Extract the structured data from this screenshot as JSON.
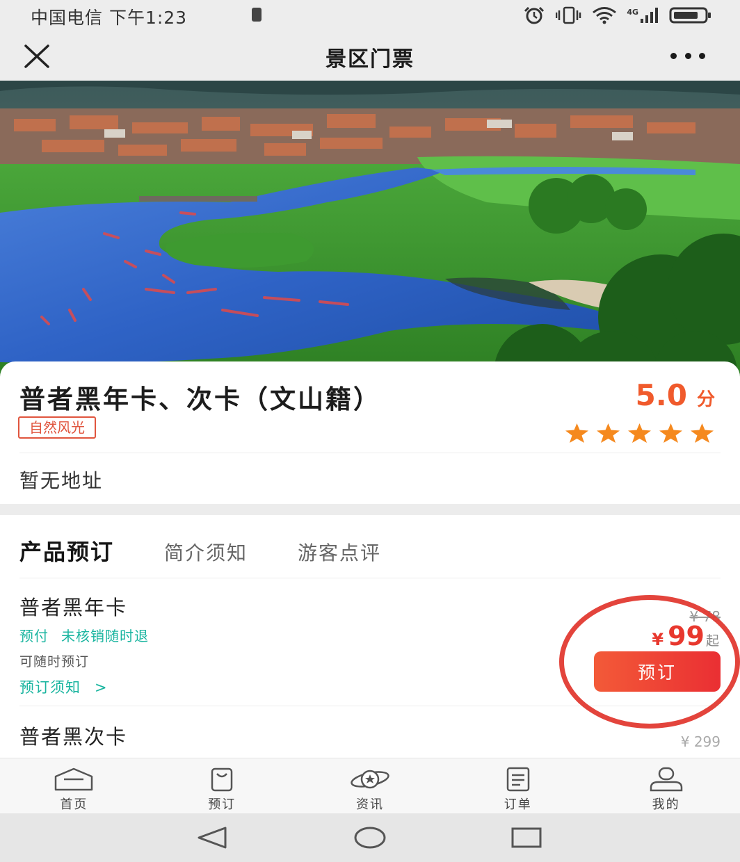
{
  "status_bar": {
    "carrier_time": "中国电信 下午1:23",
    "network_type": "4G"
  },
  "nav": {
    "title": "景区门票"
  },
  "spot": {
    "title": "普者黑年卡、次卡（文山籍）",
    "tag": "自然风光",
    "score": "5.0",
    "score_unit": "分",
    "rating_stars": 5,
    "address": "暂无地址"
  },
  "tabs": [
    "产品预订",
    "简介须知",
    "游客点评"
  ],
  "tickets": [
    {
      "name": "普者黑年卡",
      "policy": [
        "预付",
        "未核销随时退"
      ],
      "availability": "可随时预订",
      "notice": "预订须知",
      "notice_chevron": ">",
      "original_price": "¥ 78",
      "currency": "¥",
      "price": "99",
      "price_suffix": "起",
      "book_label": "预订"
    },
    {
      "name": "普者黑次卡",
      "original_price": "¥ 299"
    }
  ],
  "tabbar": [
    {
      "label": "首页",
      "icon": "home-icon"
    },
    {
      "label": "预订",
      "icon": "shopping-bag-icon"
    },
    {
      "label": "资讯",
      "icon": "planet-icon"
    },
    {
      "label": "订单",
      "icon": "document-icon"
    },
    {
      "label": "我的",
      "icon": "user-icon"
    }
  ],
  "colors": {
    "accent_red": "#e8382e",
    "score_orange": "#f05a2c",
    "teal": "#1bb5a0",
    "star_orange": "#f5891e"
  }
}
